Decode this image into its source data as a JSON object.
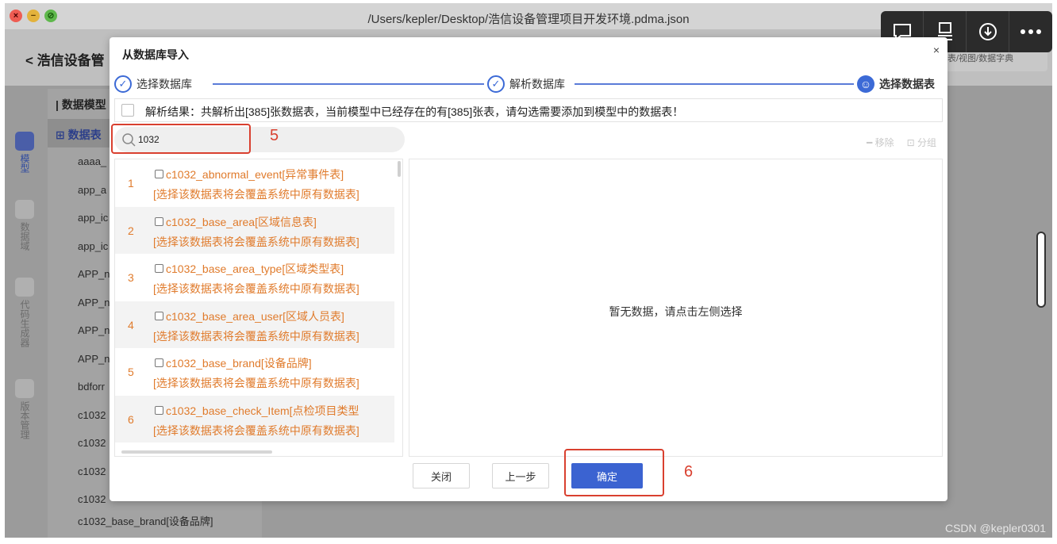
{
  "window": {
    "title": "/Users/kepler/Desktop/浩信设备管理项目开发环境.pdma.json"
  },
  "overlay_toolbar": {
    "icons": [
      "comment-icon",
      "device-icon",
      "download-icon",
      "more-icon"
    ]
  },
  "app": {
    "back_label": "浩信设备管",
    "header_hint": "表/视图/数据字典",
    "tree_header": "数据模型",
    "tree_table_label": "数据表",
    "tree_items": [
      "aaaa_",
      "app_a",
      "app_ic",
      "app_ic",
      "APP_n",
      "APP_n",
      "APP_n",
      "APP_n",
      "bdforr",
      "c1032",
      "c1032",
      "c1032",
      "c1032"
    ],
    "tree_last_item": "c1032_base_brand[设备品牌]",
    "rail": [
      {
        "label": "模型",
        "active": true
      },
      {
        "label": "数据域",
        "active": false
      },
      {
        "label": "代码生成器",
        "active": false
      },
      {
        "label": "版本管理",
        "active": false
      }
    ]
  },
  "modal": {
    "title": "从数据库导入",
    "close_symbol": "×",
    "steps": [
      {
        "label": "选择数据库",
        "state": "done"
      },
      {
        "label": "解析数据库",
        "state": "done"
      },
      {
        "label": "选择数据表",
        "state": "current"
      }
    ],
    "result_text": "解析结果：共解析出[385]张数据表，当前模型中已经存在的有[385]张表，请勾选需要添加到模型中的数据表！",
    "search": {
      "value": "1032",
      "placeholder": ""
    },
    "actions": {
      "remove": "移除",
      "group": "分组"
    },
    "rows": [
      {
        "num": "1",
        "name": "c1032_abnormal_event[异常事件表]",
        "warning": "[选择该数据表将会覆盖系统中原有数据表]"
      },
      {
        "num": "2",
        "name": "c1032_base_area[区域信息表]",
        "warning": "[选择该数据表将会覆盖系统中原有数据表]"
      },
      {
        "num": "3",
        "name": "c1032_base_area_type[区域类型表]",
        "warning": "[选择该数据表将会覆盖系统中原有数据表]"
      },
      {
        "num": "4",
        "name": "c1032_base_area_user[区域人员表]",
        "warning": "[选择该数据表将会覆盖系统中原有数据表]"
      },
      {
        "num": "5",
        "name": "c1032_base_brand[设备品牌]",
        "warning": "[选择该数据表将会覆盖系统中原有数据表]"
      },
      {
        "num": "6",
        "name": "c1032_base_check_Item[点检项目类型",
        "warning": "[选择该数据表将会覆盖系统中原有数据表]"
      }
    ],
    "empty_text": "暂无数据，请点击左侧选择",
    "buttons": {
      "close": "关闭",
      "prev": "上一步",
      "confirm": "确定"
    }
  },
  "annotations": {
    "five": "5",
    "six": "6"
  },
  "watermark": "CSDN @kepler0301",
  "colors": {
    "accent": "#3b63d1",
    "warning_text": "#e07b2c",
    "annotation": "#d9402f"
  }
}
